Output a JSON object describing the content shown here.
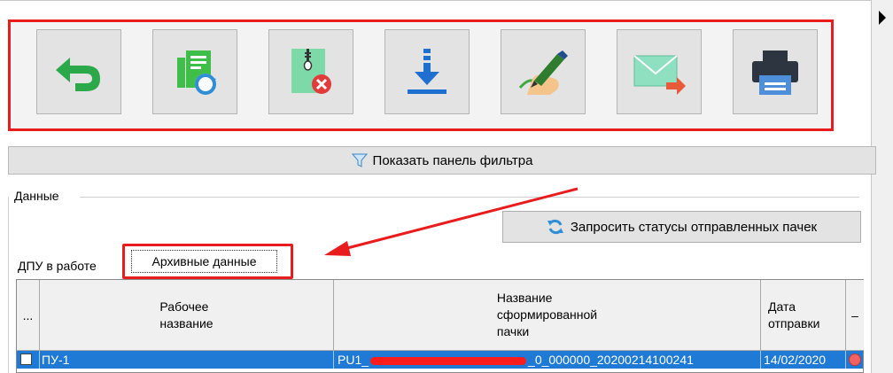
{
  "toolbar": {
    "buttons": [
      {
        "icon": "undo-arrow-icon"
      },
      {
        "icon": "document-refresh-icon"
      },
      {
        "icon": "archive-delete-icon"
      },
      {
        "icon": "download-icon"
      },
      {
        "icon": "sign-pen-icon"
      },
      {
        "icon": "send-envelope-icon"
      },
      {
        "icon": "printer-icon"
      }
    ]
  },
  "filter": {
    "label": "Показать панель фильтра",
    "icon": "funnel-icon"
  },
  "data_group": {
    "title": "Данные",
    "status_button": "Запросить статусы отправленных пачек"
  },
  "tabs": [
    {
      "label": "ДПУ в работе"
    },
    {
      "label": "Архивные данные",
      "active": true
    }
  ],
  "grid": {
    "headers": {
      "selector": "...",
      "work_name_line1": "Рабочее",
      "work_name_line2": "название",
      "pack_name_line1": "Название",
      "pack_name_line2": "сформированной",
      "pack_name_line3": "пачки",
      "date_line1": "Дата",
      "date_line2": "отправки",
      "status": "–"
    },
    "rows": [
      {
        "work_name": "ПУ-1",
        "pack_name_prefix": "PU1_",
        "pack_name_suffix": "_0_000000_20200214100241",
        "date": "14/02/2020",
        "selected": true
      }
    ]
  },
  "colors": {
    "highlight_red": "#e81c1c",
    "selection_blue": "#1e7ad4",
    "toolbar_button_bg": "#e3e3e3"
  }
}
